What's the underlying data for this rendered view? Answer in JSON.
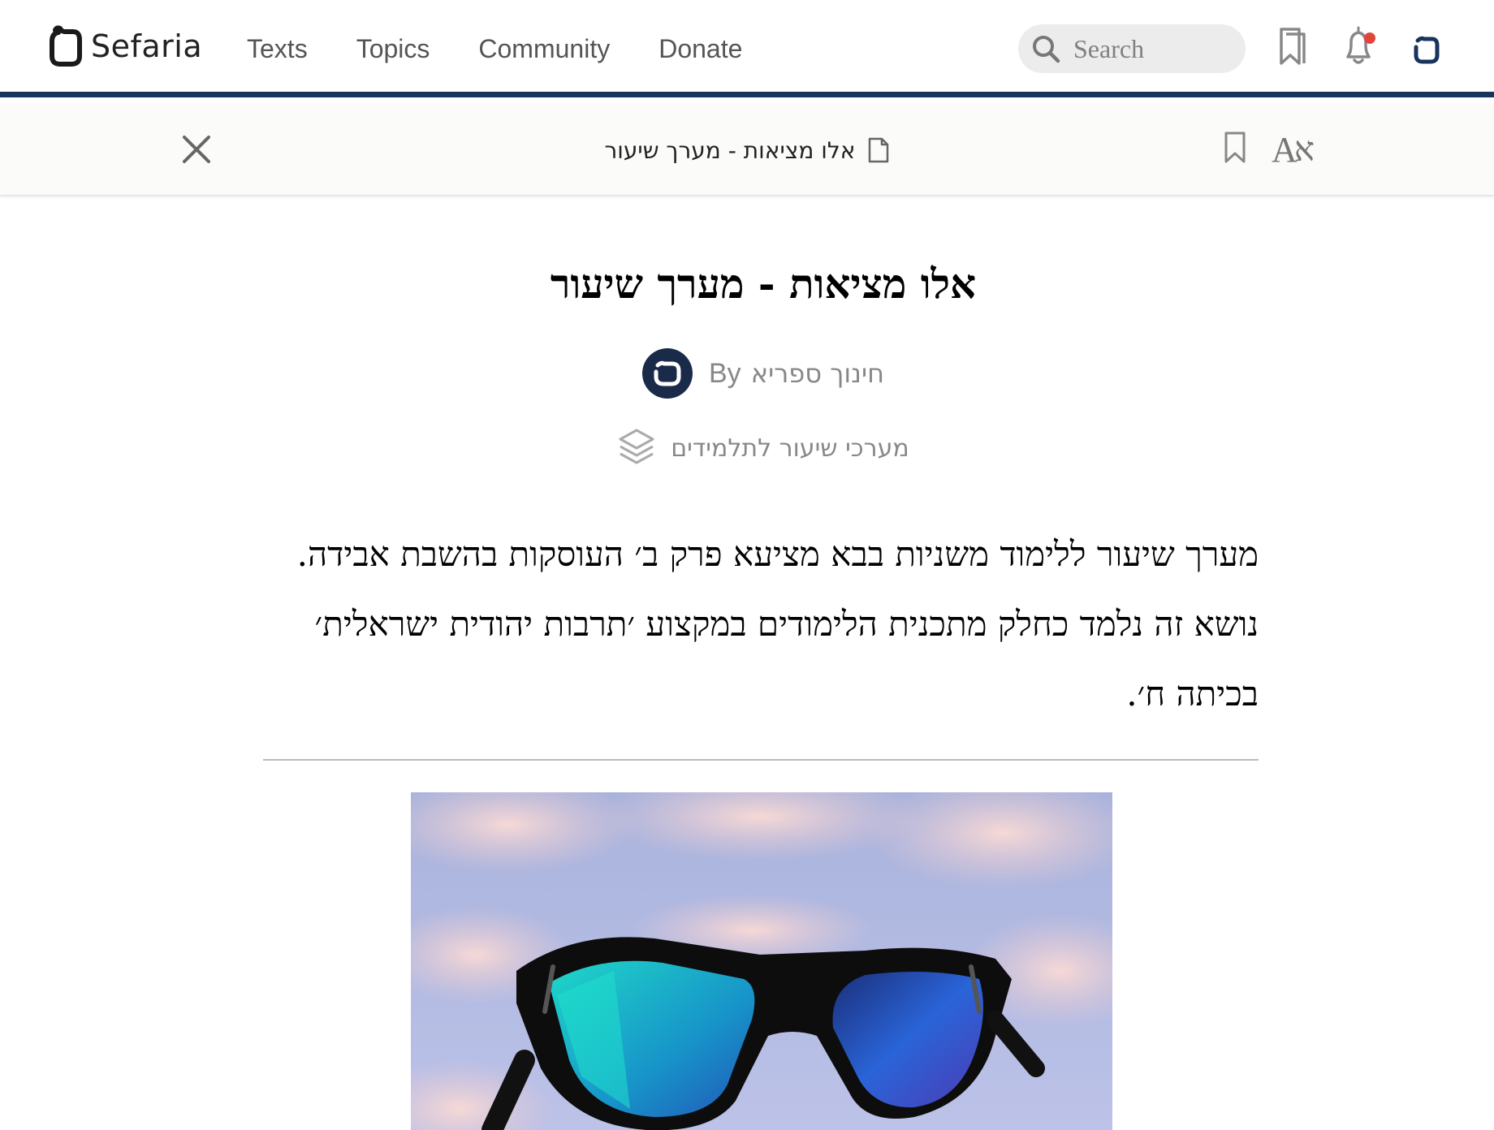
{
  "header": {
    "logo_text": "Sefaria",
    "nav": [
      "Texts",
      "Topics",
      "Community",
      "Donate"
    ],
    "search_placeholder": "Search",
    "colors": {
      "brand_navy": "#18345d",
      "notification_dot": "#e0473c"
    }
  },
  "reader": {
    "sheet_title": "אלו מציאות - מערך שיעור",
    "icons": [
      "close-icon",
      "document-icon",
      "bookmark-icon",
      "font-size-icon"
    ],
    "font_button": {
      "latin": "A",
      "hebrew": "א"
    }
  },
  "sheet": {
    "title": "אלו מציאות - מערך שיעור",
    "by_label": "By",
    "author": "חינוך ספריא",
    "collection": "מערכי שיעור לתלמידים",
    "description": "מערך שיעור ללימוד משניות בבא מציעא פרק ב׳ העוסקות בהשבת אבידה. נושא זה נלמד כחלק מתכנית הלימודים במקצוע ׳תרבות יהודית ישראלית׳ בכיתה ח׳."
  }
}
